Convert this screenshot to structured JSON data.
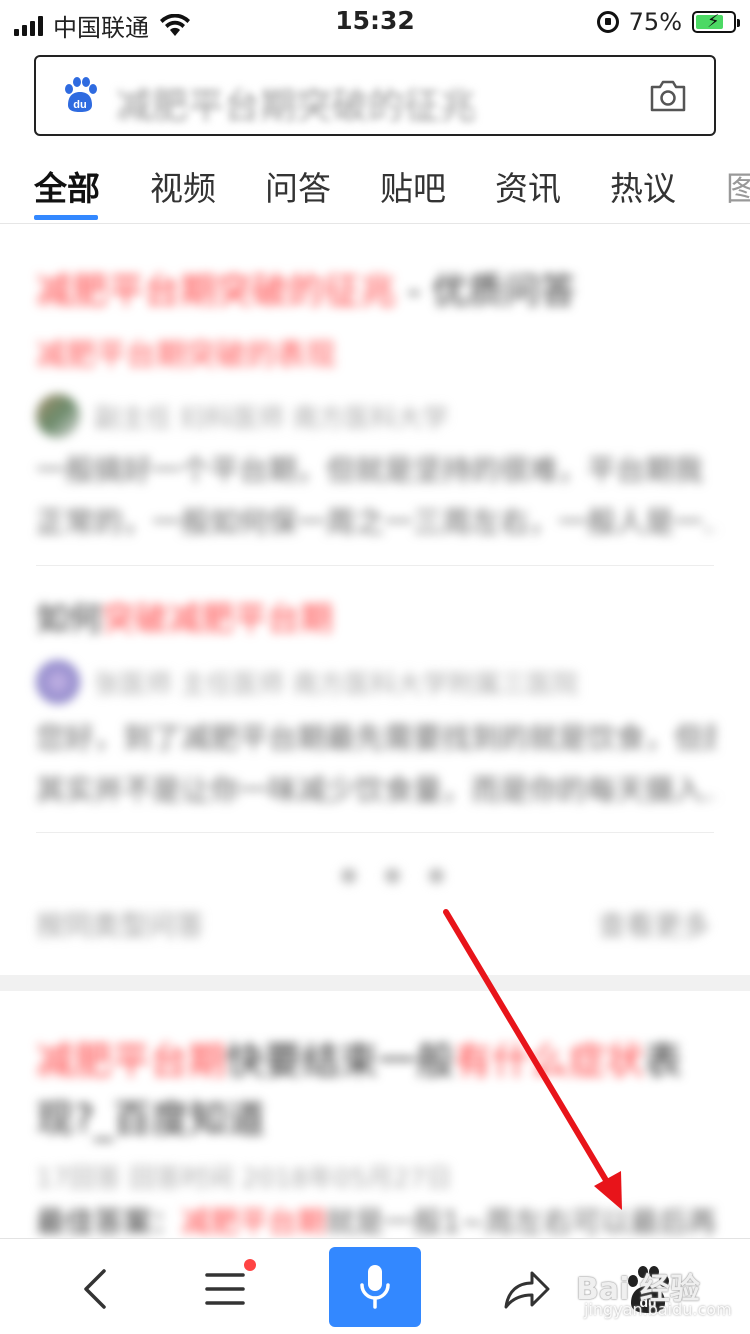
{
  "status_bar": {
    "carrier": "中国联通",
    "time": "15:32",
    "battery": "75%",
    "battery_level": 0.75
  },
  "search": {
    "query": "减肥平台期突破的征兆"
  },
  "tabs": [
    {
      "label": "全部",
      "active": true
    },
    {
      "label": "视频"
    },
    {
      "label": "问答"
    },
    {
      "label": "贴吧"
    },
    {
      "label": "资讯"
    },
    {
      "label": "热议"
    },
    {
      "label": "图"
    }
  ],
  "results": {
    "r1_title_red": "减肥平台期突破的征兆",
    "r1_title_dark": " - 优质问答",
    "r1_sub": "减肥平台期突破的表现",
    "r1_meta": "副主任 妇科医师 南方医科大学",
    "r1_snippet_1": "一般搞好一个平台期，但就是坚持的很难，平台期我",
    "r1_snippet_2": "正常的，一般如何保一周之一三周左右，一般人是一...",
    "r2_title_dark": "如何",
    "r2_title_red": "突破减肥平台期",
    "r2_meta": "张医师 主任医师 南方医科大学附属三医院",
    "r2_snippet_1": "您好，到了减肥平台期最先需要找到的就是饮食，但是",
    "r2_snippet_2": "其实并不是让你一味减少饮食量，而是你的每天摄入...",
    "footer_left": "按同类型问答",
    "footer_right": "查看更多",
    "r3_title_red_1": "减肥平台期",
    "r3_title_dark_1": "快要结束一般",
    "r3_title_red_2": "有什么症状",
    "r3_title_dark_2": "表",
    "r3_title_line2": "现?_百度知道",
    "r3_meta": "17回答  回答时间  2018年05月27日",
    "r3_snippet_dark": "最佳答案：",
    "r3_snippet_red": "减肥平台期",
    "r3_snippet_rest": "就是一般1~周左右可以最后再"
  },
  "watermark": {
    "text": "Bai 经验",
    "sub": "jingyan.baidu.com"
  },
  "colors": {
    "accent": "#3388ff",
    "annotation_arrow": "#e8141a"
  },
  "icons": {
    "back": "chevron-left-icon",
    "menu": "menu-icon",
    "voice": "microphone-icon",
    "share": "share-icon",
    "home": "baidu-paw-icon"
  }
}
